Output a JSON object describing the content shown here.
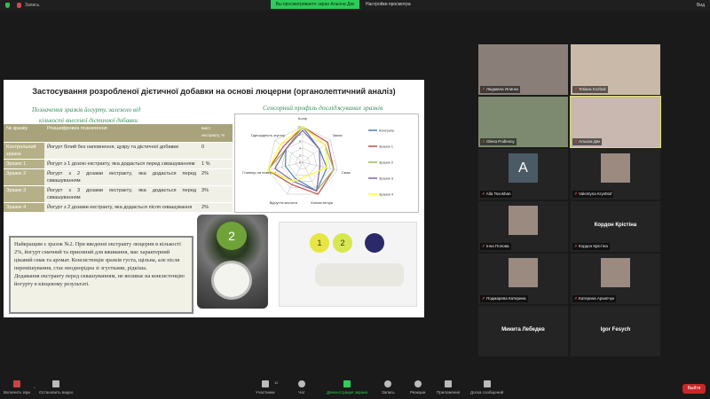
{
  "topbar": {
    "app_label": "Запись",
    "sharing_banner": "Вы просматриваете экран Альона Дяк",
    "view_options": "Настройки просмотра",
    "view_button": "Вид"
  },
  "slide": {
    "title": "Застосування розробленої дієтичної добавки на основі люцерни (органолептичний аналіз)",
    "subtitle_left_1": "Позначення зразків йогурту, залежно від",
    "subtitle_left_2": "кількості внесеної дієтичної добавки",
    "subtitle_right": "Сенсорний профіль досліджуваних зразків",
    "table": {
      "headers": [
        "№ зразку",
        "Розшифровка позначення",
        "вміст екстракту, %"
      ],
      "rows": [
        [
          "Контрольний зразок",
          "Йогурт білий без наповнення, цукру та дієтичної добавки",
          "0"
        ],
        [
          "Зразок 1",
          "Йогурт з 1 дозою екстракту, яка додається перед сквашуванням",
          "1 %"
        ],
        [
          "Зразок 2",
          "Йогурт з 2 дозами екстракту, яка додається перед сквашуванням",
          "2%"
        ],
        [
          "Зразок 3",
          "Йогурт з 3 дозами екстракту, яка додається перед сквашуванням",
          "3%"
        ],
        [
          "Зразок 4",
          "Йогурт з 2 дозами екстракту, яка додається після сквашування",
          "2%"
        ]
      ]
    },
    "note_1": "Найкращим є зразок №2. При введенні екстракту люцерни в кількості 2%, йогурт смачний та приємний для вживання, має характерний цікавий смак та аромат. Консистенція зразків густа, щільна, але після перемішування, стає неоднорідна зі згустками, рідкіша.",
    "note_2": "Додавання екстракту перед сквашуванням, не впливає на консистенцію йогурту в кінцевому результаті.",
    "photo_lid_labels": [
      "2",
      "1",
      "2"
    ]
  },
  "chart_data": {
    "type": "radar",
    "categories": [
      "Колір",
      "Запах",
      "Смак",
      "Консистенція",
      "Відчуття кислоти",
      "Глянець на поверхні",
      "Однорідність згустку"
    ],
    "range": [
      0,
      10
    ],
    "ticks": [
      "0",
      "2",
      "4",
      "6",
      "8",
      "10"
    ],
    "legend_position": "right",
    "series": [
      {
        "name": "Контроль",
        "color": "#4f81bd",
        "values": [
          10,
          6,
          7,
          9,
          5,
          5,
          6
        ]
      },
      {
        "name": "Зразок 1",
        "color": "#c0504d",
        "values": [
          10,
          9,
          9,
          10,
          7,
          10,
          7
        ]
      },
      {
        "name": "Зразок 2",
        "color": "#9bbb59",
        "values": [
          10,
          8,
          9,
          9,
          6,
          10,
          6
        ]
      },
      {
        "name": "Зразок 3",
        "color": "#8064a2",
        "values": [
          9,
          6,
          5,
          9,
          6,
          8,
          6
        ]
      },
      {
        "name": "Зразок 4",
        "color": "#ffff33",
        "values": [
          10,
          8,
          7,
          4,
          6,
          10,
          8
        ]
      }
    ]
  },
  "gallery": [
    {
      "name": "Людмила Ялинко",
      "type": "video"
    },
    {
      "name": "Tetiana Kozbuk",
      "type": "video"
    },
    {
      "name": "Olena Podlesny",
      "type": "video"
    },
    {
      "name": "Альона Дяк",
      "type": "video",
      "active": true
    },
    {
      "name": "Alla Tsvokhan",
      "type": "letter",
      "letter": "A"
    },
    {
      "name": "Valentyna Kryshtof",
      "type": "photo"
    },
    {
      "name": "Інна Попова",
      "type": "photo"
    },
    {
      "name": "Кордон Крістіна",
      "type": "name",
      "big": "Кордон Крістіна"
    },
    {
      "name": "Подмарева Катерина",
      "type": "photo"
    },
    {
      "name": "Катерина Архипчук",
      "type": "photo"
    },
    {
      "big": "Микита Лебедев",
      "type": "name"
    },
    {
      "big": "Igor Fesych",
      "type": "name"
    }
  ],
  "toolbar": {
    "unmute": "Включить звук",
    "stop_video": "Остановить видео",
    "participants": "Участники",
    "participants_count": "12",
    "chat": "Чат",
    "share": "Демонстрация экрана",
    "record": "Запись",
    "reactions": "Реакции",
    "apps": "Приложения",
    "whiteboard": "Доска сообщений",
    "leave": "Выйти"
  }
}
